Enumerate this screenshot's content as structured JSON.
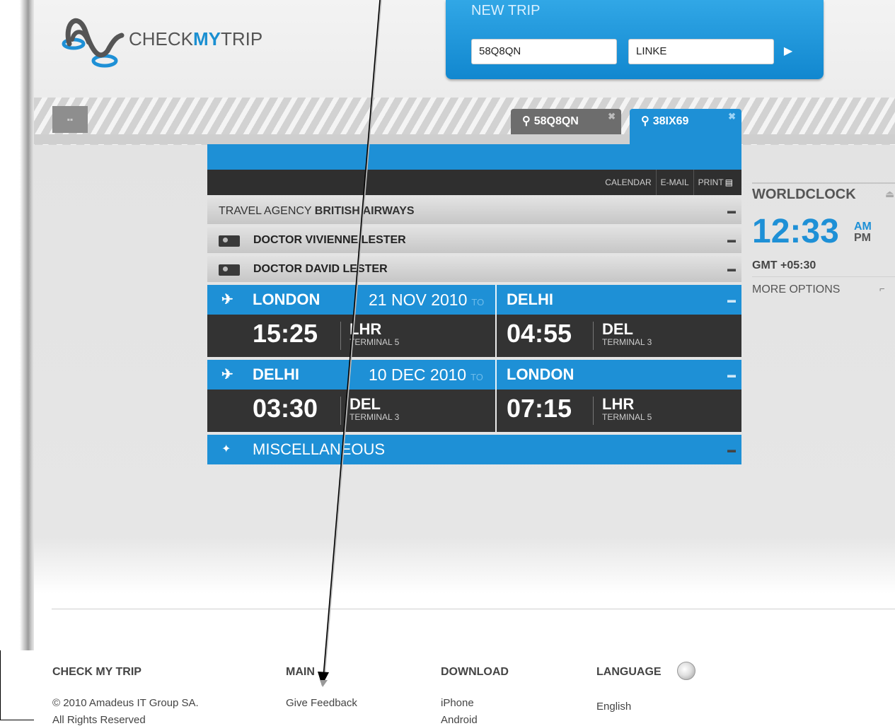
{
  "header": {
    "logo_text_1": "CHECK",
    "logo_text_2": "MY",
    "logo_text_3": "TRIP"
  },
  "new_trip": {
    "title": "NEW TRIP",
    "booking_ref_value": "58Q8QN",
    "last_name_value": "LINKE",
    "go_glyph": "▶"
  },
  "tabs": [
    {
      "label": "58Q8QN",
      "close": "✖"
    },
    {
      "label": "38IX69",
      "close": "✖"
    }
  ],
  "toolbar": {
    "calendar": "CALENDAR",
    "email": "E-MAIL",
    "print": "PRINT"
  },
  "agency": {
    "prefix": "TRAVEL AGENCY",
    "name": "BRITISH AIRWAYS"
  },
  "travellers": [
    "DOCTOR VIVIENNE LESTER",
    "DOCTOR DAVID LESTER"
  ],
  "flights": [
    {
      "from_city": "LONDON",
      "date": "21 NOV 2010",
      "to_word": "TO",
      "to_city": "DELHI",
      "dep_time": "15:25",
      "dep_code": "LHR",
      "dep_terminal": "TERMINAL 5",
      "arr_time": "04:55",
      "arr_code": "DEL",
      "arr_terminal": "TERMINAL 3"
    },
    {
      "from_city": "DELHI",
      "date": "10 DEC 2010",
      "to_word": "TO",
      "to_city": "LONDON",
      "dep_time": "03:30",
      "dep_code": "DEL",
      "dep_terminal": "TERMINAL 3",
      "arr_time": "07:15",
      "arr_code": "LHR",
      "arr_terminal": "TERMINAL 5"
    }
  ],
  "misc_label": "MISCELLANEOUS",
  "worldclock": {
    "title": "WORLDCLOCK",
    "time": "12:33",
    "am": "AM",
    "pm": "PM",
    "gmt": "GMT +05:30",
    "more": "MORE OPTIONS"
  },
  "footer": {
    "col1_title": "CHECK MY TRIP",
    "col1_line1": "© 2010 Amadeus IT Group SA.",
    "col1_line2": "All Rights Reserved",
    "col2_title": "MAIN",
    "col2_link1": "Give Feedback",
    "col3_title": "DOWNLOAD",
    "col3_link1": "iPhone",
    "col3_link2": "Android",
    "col4_title": "LANGUAGE",
    "col4_value": "English"
  },
  "colors": {
    "accent": "#1e90d6",
    "dark_bar": "#333333",
    "grey_row": "#d0d0d0"
  },
  "icons": [
    "logo-icon",
    "home-icon",
    "pin-icon",
    "close-icon",
    "plane-icon",
    "person-icon",
    "print-icon",
    "collapse-icon",
    "eject-icon",
    "options-icon",
    "sparkle-icon",
    "globe-icon"
  ]
}
